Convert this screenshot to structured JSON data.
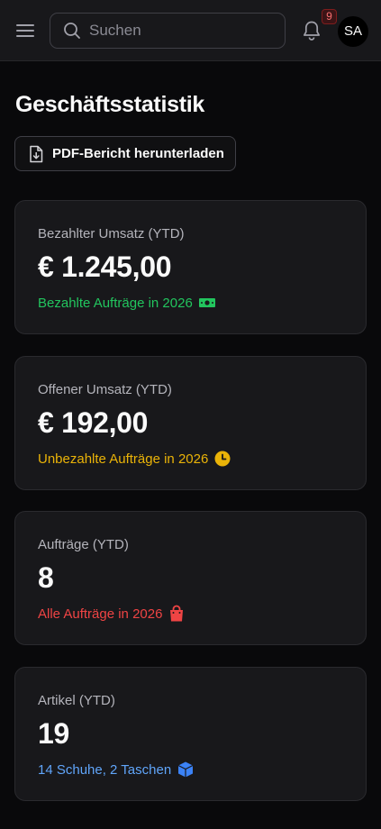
{
  "header": {
    "search_placeholder": "Suchen",
    "notification_count": "9",
    "avatar_initials": "SA"
  },
  "main": {
    "title": "Geschäftsstatistik",
    "pdf_button_label": "PDF-Bericht herunterladen"
  },
  "cards": [
    {
      "label": "Bezahlter Umsatz (YTD)",
      "value": "€ 1.245,00",
      "subtitle": "Bezahlte Aufträge in 2026",
      "icon": "money-icon",
      "color": "#22c55e"
    },
    {
      "label": "Offener Umsatz (YTD)",
      "value": "€ 192,00",
      "subtitle": "Unbezahlte Aufträge in 2026",
      "icon": "clock-icon",
      "color": "#eab308"
    },
    {
      "label": "Aufträge (YTD)",
      "value": "8",
      "subtitle": "Alle Aufträge in 2026",
      "icon": "shopping-bag-icon",
      "color": "#ef4444"
    },
    {
      "label": "Artikel (YTD)",
      "value": "19",
      "subtitle": "14 Schuhe, 2 Taschen",
      "icon": "package-icon",
      "color": "#60a5fa"
    }
  ]
}
